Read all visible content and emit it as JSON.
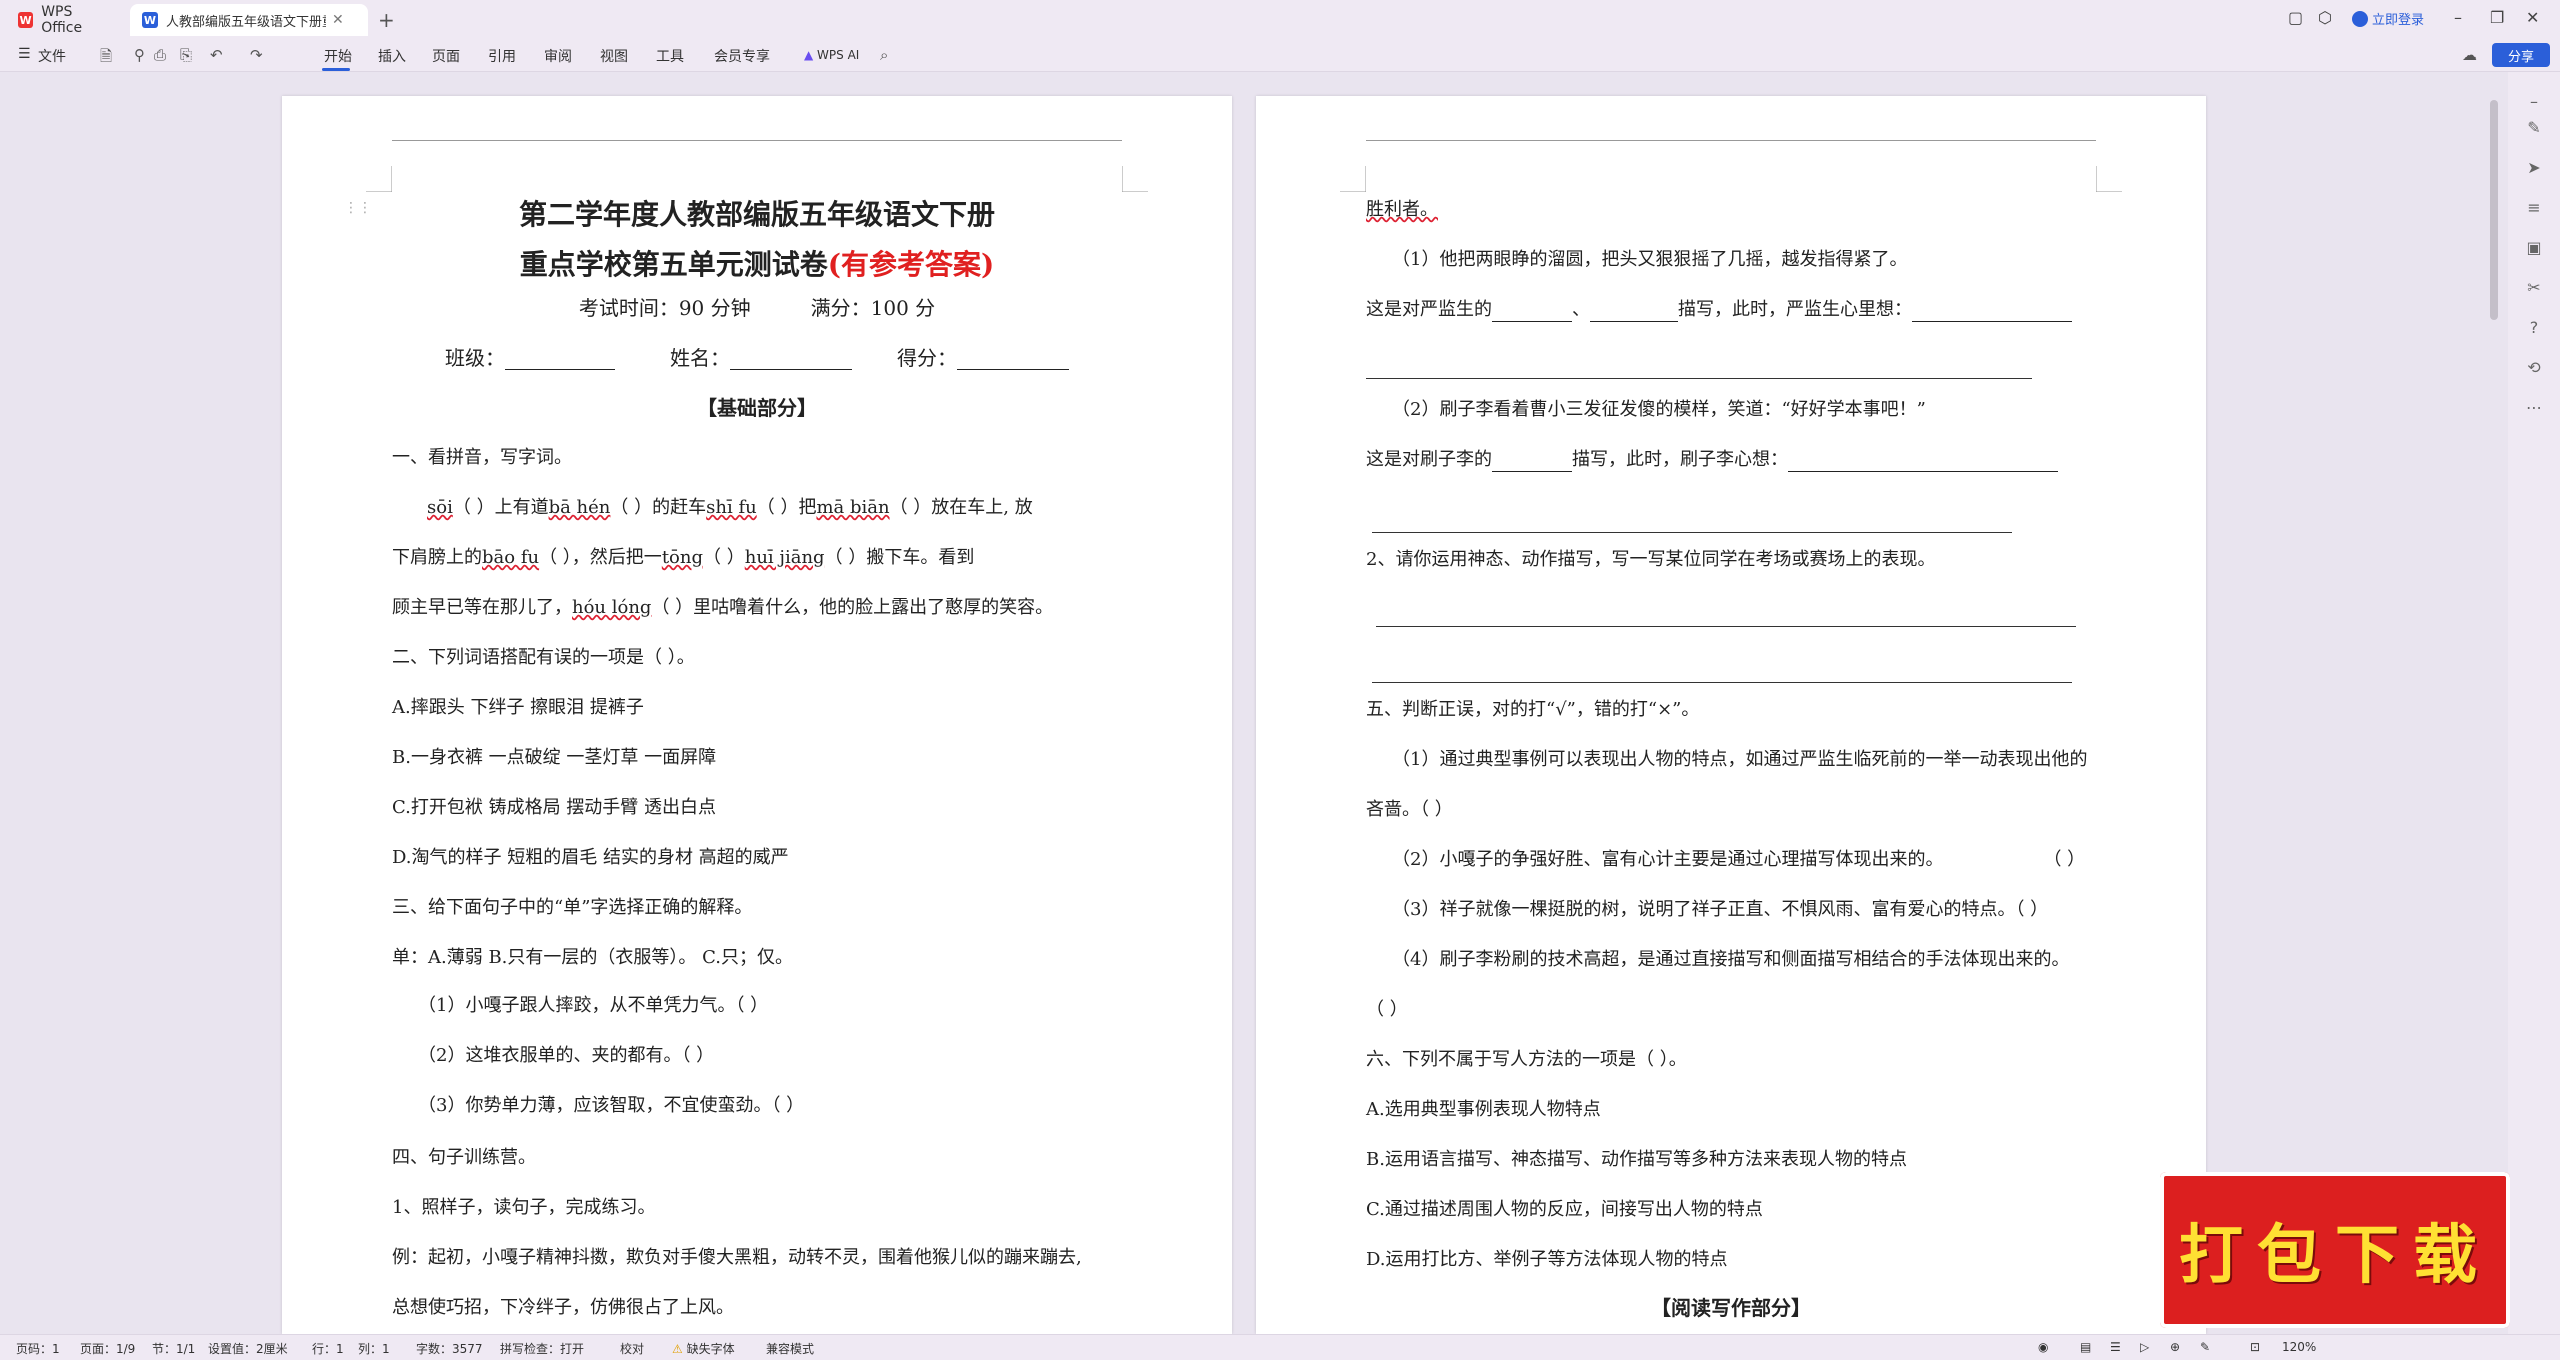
{
  "titlebar": {
    "home_tab": "WPS Office",
    "doc_tab": "人教部编版五年级语文下册重点学校第五单元测试卷",
    "login": "立即登录"
  },
  "ribbon": {
    "file_menu": "文件",
    "tabs": [
      "开始",
      "插入",
      "页面",
      "引用",
      "审阅",
      "视图",
      "工具",
      "会员专享"
    ],
    "active_tab": "开始",
    "wps_ai": "WPS AI",
    "share": "分享"
  },
  "left_page": {
    "title1": "第二学年度人教部编版五年级语文下册",
    "title2_main": "重点学校第五单元测试卷",
    "title2_red": "(有参考答案)",
    "exam_time": "考试时间：90 分钟",
    "full_score": "满分：100 分",
    "class_label": "班级：",
    "name_label": "姓名：",
    "score_label": "得分：",
    "basic_section": "【基础部分】",
    "q1": "一、看拼音，写字词。",
    "q1_p1_a": "sōi",
    "q1_p1_b": "（ ）上有道",
    "q1_p1_c": "bā hén",
    "q1_p1_d": "（ ）的赶车",
    "q1_p1_e": "shī fu",
    "q1_p1_f": "（    ）把",
    "q1_p1_g": "mā  biān",
    "q1_p1_h": "（ ）放在车上, 放",
    "q1_p2_a": "下肩膀上的",
    "q1_p2_b": "bāo   fu",
    "q1_p2_c": "（ ），然后把一",
    "q1_p2_d": "tōng",
    "q1_p2_e": "（      ）",
    "q1_p2_f": "huī  jiāng",
    "q1_p2_g": "（      ）搬下车。看到",
    "q1_p3_a": "顾主早已等在那儿了，",
    "q1_p3_b": "hóu   lóng",
    "q1_p3_c": "（      ）里咕噜着什么，他的脸上露出了憨厚的笑容。",
    "q2": "二、下列词语搭配有误的一项是（  ）。",
    "q2_a": "A.摔跟头          下绊子          擦眼泪          提裤子",
    "q2_b": "B.一身衣裤        一点破绽        一茎灯草        一面屏障",
    "q2_c": "C.打开包袱        铸成格局        摆动手臂        透出白点",
    "q2_d": "D.淘气的样子    短粗的眉毛    结实的身材    高超的威严",
    "q3": "三、给下面句子中的“单”字选择正确的解释。",
    "q3_opts": "单：A.薄弱          B.只有一层的（衣服等）。        C.只；仅。",
    "q3_1": "（1）小嘎子跟人摔跤，从不单凭力气。（    ）",
    "q3_2": "（2）这堆衣服单的、夹的都有。（      ）",
    "q3_3": "（3）你势单力薄，应该智取，不宜使蛮劲。（    ）",
    "q4": "四、句子训练营。",
    "q4_1": "1、照样子，读句子，完成练习。",
    "q4_ex1": "例：起初，小嘎子精神抖擞，欺负对手傻大黑粗，动转不灵，围着他猴儿似的蹦来蹦去,",
    "q4_ex2": "总想使巧招，下冷绊子，仿佛很占了上风。"
  },
  "right_page": {
    "l0": "胜利者。",
    "l1": "（1）他把两眼睁的溜圆，把头又狠狠摇了几摇，越发指得紧了。",
    "l2_a": "这是对严监生的",
    "l2_b": "、",
    "l2_c": "描写，此时，严监生心里想：",
    "l3": "（2）刷子李看着曹小三发征发傻的模样，笑道：“好好学本事吧！”",
    "l4_a": "这是对刷子李的",
    "l4_b": "描写，此时，刷子李心想：",
    "l5": "2、请你运用神态、动作描写，写一写某位同学在考场或赛场上的表现。",
    "q5": "五、判断正误，对的打“√”，错的打“×”。",
    "q5_1a": "（1）通过典型事例可以表现出人物的特点，如通过严监生临死前的一举一动表现出他的",
    "q5_1b": "吝啬。（    ）",
    "q5_2": "（2）小嘎子的争强好胜、富有心计主要是通过心理描写体现出来的。",
    "q5_2p": "（    ）",
    "q5_3": "（3）祥子就像一棵挺脱的树，说明了祥子正直、不惧风雨、富有爱心的特点。（    ）",
    "q5_4a": "（4）刷子李粉刷的技术高超，是通过直接描写和侧面描写相结合的手法体现出来的。",
    "q5_4b": "（    ）",
    "q6": "六、下列不属于写人方法的一项是（      ）。",
    "q6_a": "A.选用典型事例表现人物特点",
    "q6_b": "B.运用语言描写、神态描写、动作描写等多种方法来表现人物的特点",
    "q6_c": "C.通过描述周围人物的反应，间接写出人物的特点",
    "q6_d": "D.运用打比方、举例子等方法体现人物的特点",
    "reading_section": "【阅读写作部分】"
  },
  "promo": "打包下载",
  "statusbar": {
    "page_code": "页码：1",
    "pages": "页面：1/9",
    "section": "节：1/1",
    "setting": "设置值：2厘米",
    "row": "行：1",
    "col": "列：1",
    "words": "字数：3577",
    "spell": "拼写检查：打开",
    "proof": "校对",
    "missing_font": "缺失字体",
    "compat": "兼容模式",
    "zoom": "120%"
  },
  "colors": {
    "accent": "#2b5fd9",
    "title_red": "#e02020",
    "promo_red": "#dc1f1f"
  }
}
